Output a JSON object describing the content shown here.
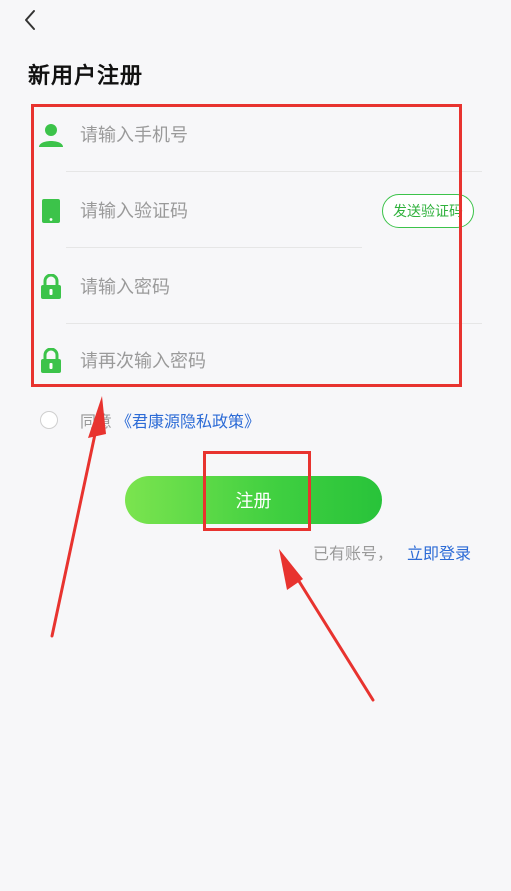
{
  "header": {
    "back_icon": "chevron-left-icon",
    "title": "新用户注册"
  },
  "form": {
    "phone": {
      "placeholder": "请输入手机号",
      "value": "",
      "icon": "person-icon"
    },
    "code": {
      "placeholder": "请输入验证码",
      "value": "",
      "icon": "phone-icon",
      "send_code_label": "发送验证码"
    },
    "password": {
      "placeholder": "请输入密码",
      "value": "",
      "icon": "lock-icon"
    },
    "password_confirm": {
      "placeholder": "请再次输入密码",
      "value": "",
      "icon": "lock-icon"
    }
  },
  "agreement": {
    "checked": false,
    "prefix": "同意",
    "policy_link": "《君康源隐私政策》"
  },
  "register_button": {
    "label": "注册"
  },
  "login": {
    "hint": "已有账号，",
    "link": "立即登录"
  },
  "colors": {
    "accent_green": "#3cc34a",
    "link_blue": "#2c6bd6",
    "annotation_red": "#e8332f"
  }
}
